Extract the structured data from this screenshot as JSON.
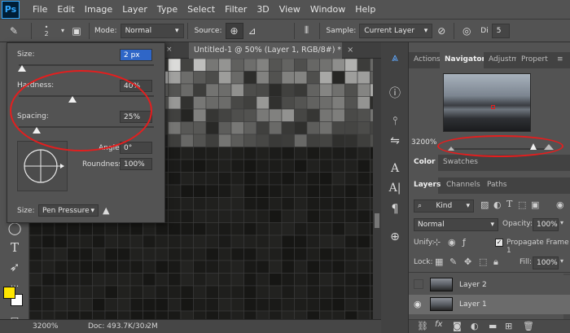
{
  "app": {
    "logo": "Ps"
  },
  "menu": [
    "File",
    "Edit",
    "Image",
    "Layer",
    "Type",
    "Select",
    "Filter",
    "3D",
    "View",
    "Window",
    "Help"
  ],
  "options": {
    "brush_size": "2",
    "mode_label": "Mode:",
    "mode_value": "Normal",
    "source_label": "Source:",
    "sample_label": "Sample:",
    "sample_value": "Current Layer",
    "diffusion_label": "Di",
    "diffusion_value": "5"
  },
  "brush_popup": {
    "size_label": "Size:",
    "size_value": "2 px",
    "hardness_label": "Hardness:",
    "hardness_value": "40%",
    "hardness_level": 0.4,
    "spacing_label": "Spacing:",
    "spacing_value": "25%",
    "spacing_level": 0.25,
    "angle_label": "Angle:",
    "angle_value": "0°",
    "roundness_label": "Roundness:",
    "roundness_value": "100%",
    "size_control_label": "Size:",
    "size_control_value": "Pen Pressure"
  },
  "document": {
    "tab_title": "Untitled-1 @ 50% (Layer 1, RGB/8#) *",
    "zoom": "3200%",
    "doc_size": "Doc: 493.7K/30.2M"
  },
  "panels": {
    "top_tabs": [
      "Actions",
      "Navigator",
      "Adjustm",
      "Propert"
    ],
    "navigator_zoom": "3200%",
    "color_tabs": [
      "Color",
      "Swatches"
    ],
    "layer_tabs": [
      "Layers",
      "Channels",
      "Paths"
    ],
    "kind_label": "Kind",
    "blend_mode": "Normal",
    "opacity_label": "Opacity:",
    "opacity_value": "100%",
    "unify_label": "Unify:",
    "propagate_label": "Propagate Frame 1",
    "lock_label": "Lock:",
    "fill_label": "Fill:",
    "fill_value": "100%",
    "layers": [
      {
        "name": "Layer 2",
        "visible": false
      },
      {
        "name": "Layer 1",
        "visible": true
      }
    ]
  },
  "colors": {
    "foreground": "#ffe600",
    "background": "#ffffff",
    "annotation": "#e41e1e"
  }
}
